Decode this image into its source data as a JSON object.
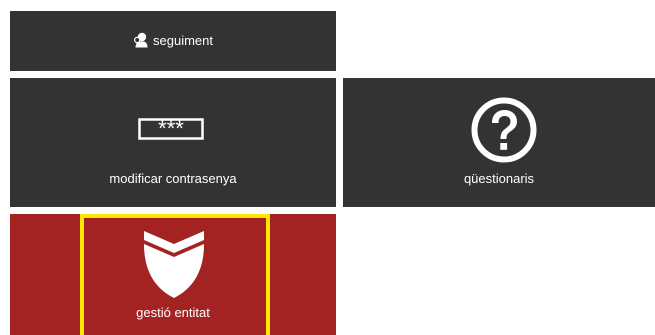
{
  "tiles": {
    "seguiment": {
      "label": "seguiment",
      "icon": "user-key-icon"
    },
    "contrasenya": {
      "label": "modificar contrasenya",
      "icon": "password-field-icon",
      "mask": "***"
    },
    "questionaris": {
      "label": "qüestionaris",
      "icon": "question-circle-icon"
    },
    "entitat": {
      "label": "gestió entitat",
      "icon": "shield-icon",
      "focused": true
    }
  },
  "colors": {
    "tile_dark": "#333333",
    "tile_active": "#a32323",
    "focus_outline": "#ffe800",
    "text": "#ffffff"
  }
}
